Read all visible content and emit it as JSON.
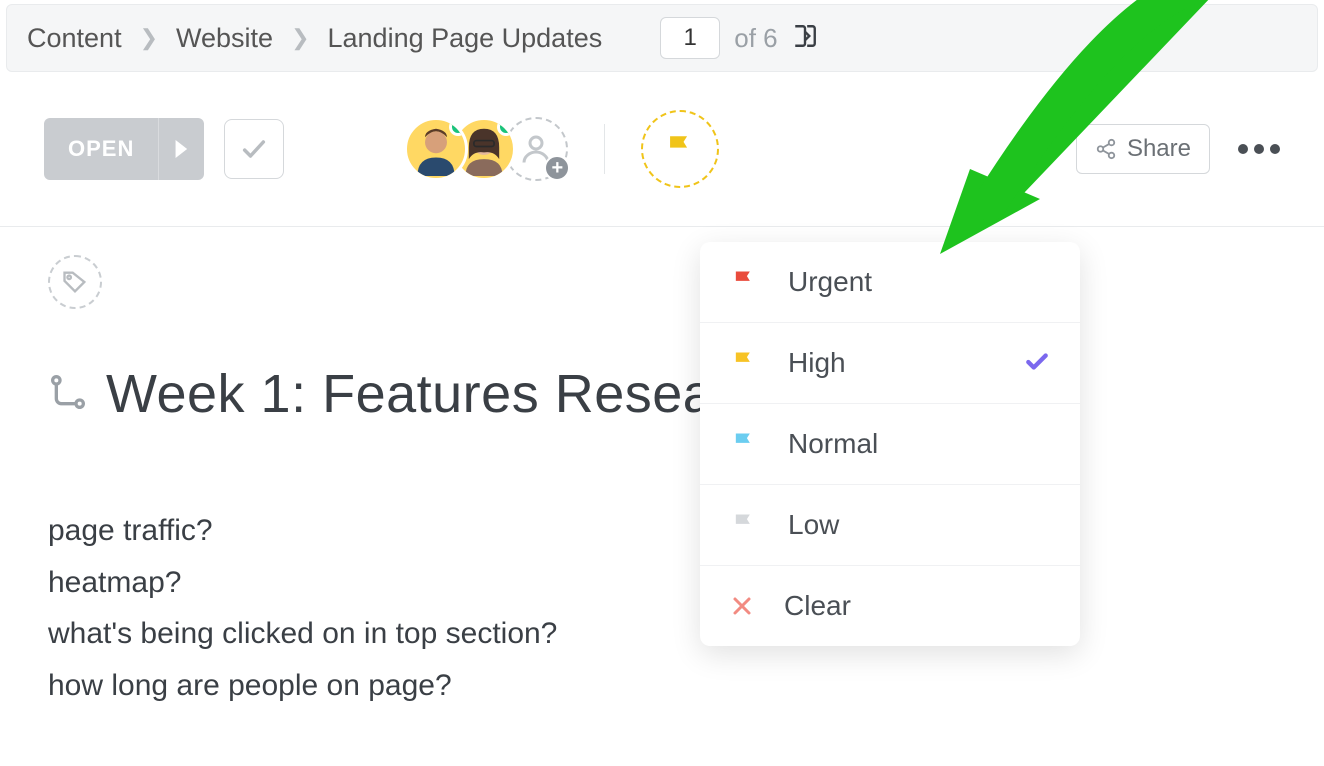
{
  "breadcrumb": {
    "items": [
      "Content",
      "Website",
      "Landing Page Updates"
    ],
    "page_current": "1",
    "page_total": "of 6"
  },
  "toolbar": {
    "open_label": "OPEN",
    "share_label": "Share"
  },
  "content": {
    "title": "Week 1: Features Resea",
    "body_lines": [
      "page traffic?",
      "heatmap?",
      "what's being clicked on in top section?",
      "how long are people on page?"
    ]
  },
  "priority_menu": {
    "items": [
      {
        "label": "Urgent",
        "color": "#e94b3c",
        "selected": false,
        "type": "flag"
      },
      {
        "label": "High",
        "color": "#f7c325",
        "selected": true,
        "type": "flag"
      },
      {
        "label": "Normal",
        "color": "#6bcdf0",
        "selected": false,
        "type": "flag"
      },
      {
        "label": "Low",
        "color": "#d5d8db",
        "selected": false,
        "type": "flag"
      },
      {
        "label": "Clear",
        "color": "#f28b82",
        "selected": false,
        "type": "clear"
      }
    ]
  }
}
